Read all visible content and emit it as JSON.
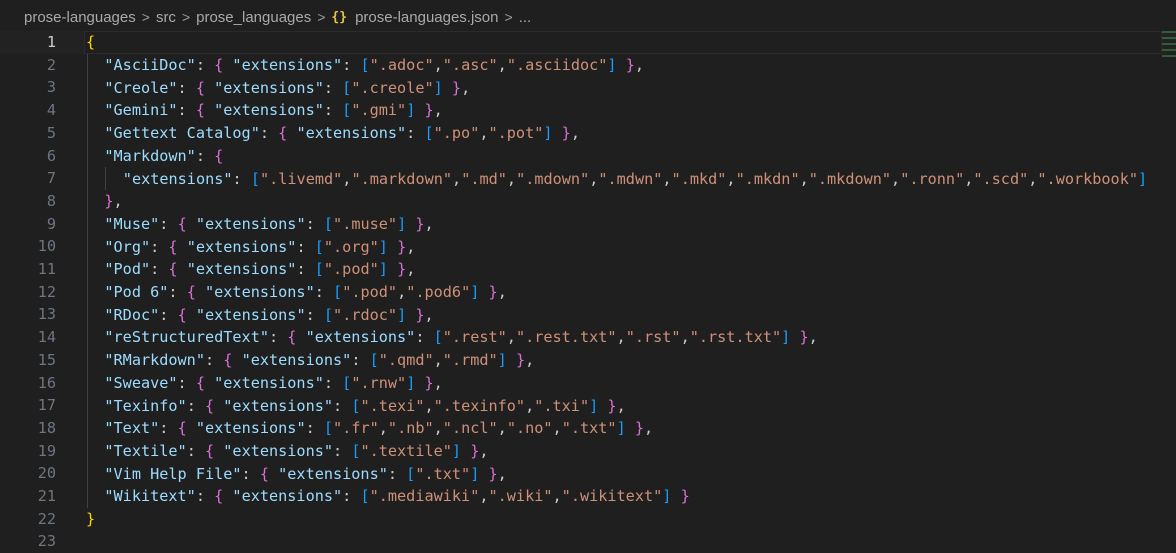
{
  "breadcrumb": {
    "items": [
      "prose-languages",
      "src",
      "prose_languages",
      "prose-languages.json",
      "..."
    ],
    "separator": ">",
    "file_icon": "{}"
  },
  "editor": {
    "active_line": 1,
    "lines": [
      {
        "n": "1",
        "indent": 0,
        "text": "{"
      },
      {
        "n": "2",
        "indent": 1,
        "key": "\"AsciiDoc\"",
        "exts": [
          "\".adoc\"",
          "\".asc\"",
          "\".asciidoc\""
        ],
        "tail": ","
      },
      {
        "n": "3",
        "indent": 1,
        "key": "\"Creole\"",
        "exts": [
          "\".creole\""
        ],
        "tail": ","
      },
      {
        "n": "4",
        "indent": 1,
        "key": "\"Gemini\"",
        "exts": [
          "\".gmi\""
        ],
        "tail": ","
      },
      {
        "n": "5",
        "indent": 1,
        "key": "\"Gettext Catalog\"",
        "exts": [
          "\".po\"",
          "\".pot\""
        ],
        "tail": ","
      },
      {
        "n": "6",
        "indent": 1,
        "text": "\"Markdown\": {",
        "open": true
      },
      {
        "n": "7",
        "indent": 2,
        "text": "\"extensions\": [\".livemd\",\".markdown\",\".md\",\".mdown\",\".mdwn\",\".mkd\",\".mkdn\",\".mkdown\",\".ronn\",\".scd\",\".workbook\"]",
        "inner": true
      },
      {
        "n": "8",
        "indent": 1,
        "text": "},",
        "close": true
      },
      {
        "n": "9",
        "indent": 1,
        "key": "\"Muse\"",
        "exts": [
          "\".muse\""
        ],
        "tail": ","
      },
      {
        "n": "10",
        "indent": 1,
        "key": "\"Org\"",
        "exts": [
          "\".org\""
        ],
        "tail": ","
      },
      {
        "n": "11",
        "indent": 1,
        "key": "\"Pod\"",
        "exts": [
          "\".pod\""
        ],
        "tail": ","
      },
      {
        "n": "12",
        "indent": 1,
        "key": "\"Pod 6\"",
        "exts": [
          "\".pod\"",
          "\".pod6\""
        ],
        "tail": ","
      },
      {
        "n": "13",
        "indent": 1,
        "key": "\"RDoc\"",
        "exts": [
          "\".rdoc\""
        ],
        "tail": ","
      },
      {
        "n": "14",
        "indent": 1,
        "key": "\"reStructuredText\"",
        "exts": [
          "\".rest\"",
          "\".rest.txt\"",
          "\".rst\"",
          "\".rst.txt\""
        ],
        "tail": ","
      },
      {
        "n": "15",
        "indent": 1,
        "key": "\"RMarkdown\"",
        "exts": [
          "\".qmd\"",
          "\".rmd\""
        ],
        "tail": ","
      },
      {
        "n": "16",
        "indent": 1,
        "key": "\"Sweave\"",
        "exts": [
          "\".rnw\""
        ],
        "tail": ","
      },
      {
        "n": "17",
        "indent": 1,
        "key": "\"Texinfo\"",
        "exts": [
          "\".texi\"",
          "\".texinfo\"",
          "\".txi\""
        ],
        "tail": ","
      },
      {
        "n": "18",
        "indent": 1,
        "key": "\"Text\"",
        "exts": [
          "\".fr\"",
          "\".nb\"",
          "\".ncl\"",
          "\".no\"",
          "\".txt\""
        ],
        "tail": ","
      },
      {
        "n": "19",
        "indent": 1,
        "key": "\"Textile\"",
        "exts": [
          "\".textile\""
        ],
        "tail": ","
      },
      {
        "n": "20",
        "indent": 1,
        "key": "\"Vim Help File\"",
        "exts": [
          "\".txt\""
        ],
        "tail": ","
      },
      {
        "n": "21",
        "indent": 1,
        "key": "\"Wikitext\"",
        "exts": [
          "\".mediawiki\"",
          "\".wiki\"",
          "\".wikitext\""
        ],
        "tail": ""
      },
      {
        "n": "22",
        "indent": 0,
        "text": "}"
      },
      {
        "n": "23",
        "indent": 0,
        "text": ""
      }
    ],
    "ext_key": "\"extensions\""
  },
  "colors": {
    "background": "#1f1f1f",
    "key": "#9cdcfe",
    "string": "#ce9178",
    "bracket_level1": "#ffd700",
    "bracket_level2": "#da70d6",
    "bracket_level3": "#179fff"
  }
}
